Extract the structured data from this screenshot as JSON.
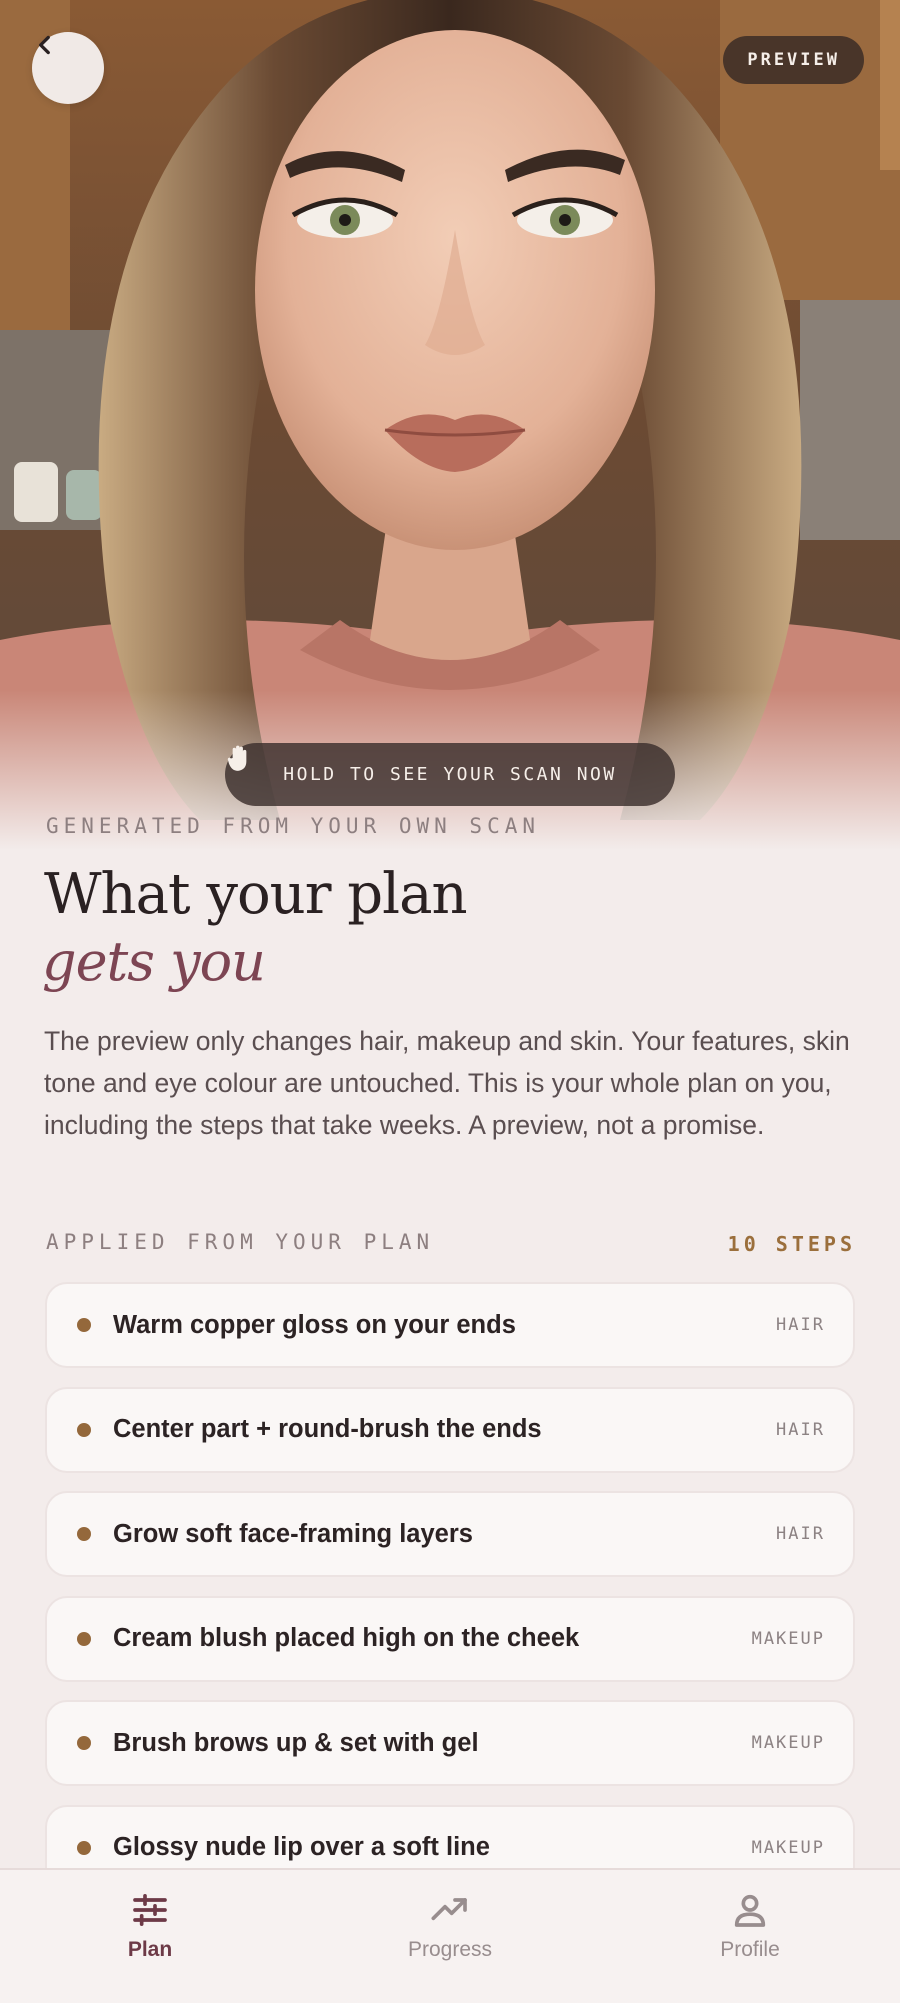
{
  "header": {
    "back_icon": "chevron-left-icon",
    "preview_label": "PREVIEW",
    "hold_label": "HOLD TO SEE YOUR SCAN NOW",
    "hold_icon": "hand-icon"
  },
  "intro": {
    "eyebrow": "GENERATED FROM YOUR OWN SCAN",
    "title_line1": "What your plan",
    "title_line2": "gets you",
    "body": "The preview only changes hair, makeup and skin. Your features, skin tone and eye colour are untouched. This is your whole plan on you, including the steps that take weeks. A preview, not a promise."
  },
  "plan": {
    "heading": "APPLIED FROM YOUR PLAN",
    "count": "10 STEPS",
    "items": [
      {
        "label": "Warm copper gloss on your ends",
        "tag": "HAIR"
      },
      {
        "label": "Center part + round-brush the ends",
        "tag": "HAIR"
      },
      {
        "label": "Grow soft face-framing layers",
        "tag": "HAIR"
      },
      {
        "label": "Cream blush placed high on the cheek",
        "tag": "MAKEUP"
      },
      {
        "label": "Brush brows up & set with gel",
        "tag": "MAKEUP"
      },
      {
        "label": "Glossy nude lip over a soft line",
        "tag": "MAKEUP"
      }
    ]
  },
  "nav": {
    "items": [
      {
        "label": "Plan",
        "icon": "sliders-icon",
        "active": true
      },
      {
        "label": "Progress",
        "icon": "trend-up-icon",
        "active": false
      },
      {
        "label": "Profile",
        "icon": "person-icon",
        "active": false
      }
    ]
  },
  "colors": {
    "accent": "#7d4553",
    "step_dot": "#94683b",
    "background": "#f3eceb"
  }
}
